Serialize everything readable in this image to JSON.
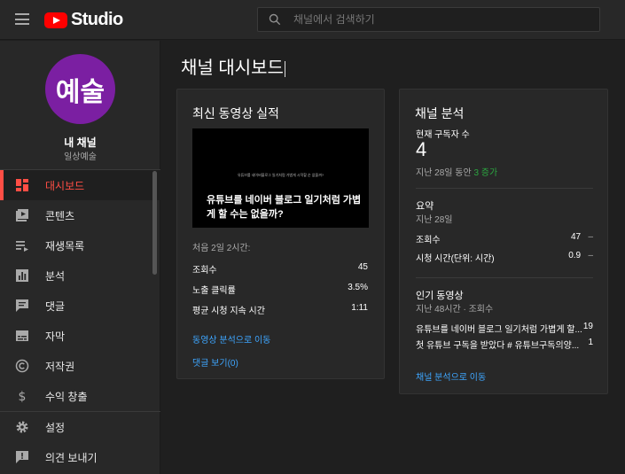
{
  "topbar": {
    "logo_text": "Studio",
    "search_placeholder": "채널에서 검색하기"
  },
  "sidebar": {
    "avatar_text": "예술",
    "channel_name": "내 채널",
    "channel_sub": "일상예술",
    "items": [
      {
        "label": "대시보드",
        "icon": "dashboard-icon"
      },
      {
        "label": "콘텐츠",
        "icon": "video-library-icon"
      },
      {
        "label": "재생목록",
        "icon": "playlist-icon"
      },
      {
        "label": "분석",
        "icon": "analytics-icon"
      },
      {
        "label": "댓글",
        "icon": "comment-icon"
      },
      {
        "label": "자막",
        "icon": "subtitles-icon"
      },
      {
        "label": "저작권",
        "icon": "copyright-icon"
      },
      {
        "label": "수익 창출",
        "icon": "dollar-icon"
      }
    ],
    "bottom_items": [
      {
        "label": "설정",
        "icon": "gear-icon"
      },
      {
        "label": "의견 보내기",
        "icon": "feedback-icon"
      }
    ],
    "accent_color": "#ff4e45"
  },
  "main": {
    "page_title": "채널 대시보드"
  },
  "latest_video": {
    "title": "최신 동영상 실적",
    "thumb_small_text": "유튜브를 네이버블로그 일기처럼 가볍게 시작할 순 없을까?",
    "thumb_big_text": "유튜브를 네이버 블로그 일기처럼 가볍게 할 수는 없을까?",
    "period": "처음 2일 2시간:",
    "stats": [
      {
        "label": "조회수",
        "value": "45"
      },
      {
        "label": "노출 클릭률",
        "value": "3.5%"
      },
      {
        "label": "평균 시청 지속 시간",
        "value": "1:11"
      }
    ],
    "link_analytics": "동영상 분석으로 이동",
    "link_comments": "댓글 보기(0)"
  },
  "channel_analytics": {
    "title": "채널 분석",
    "subs_label": "현재 구독자 수",
    "subs_value": "4",
    "subs_period": "지난 28일 동안",
    "subs_change": "3 증가",
    "summary_title": "요약",
    "summary_period": "지난 28일",
    "summary_rows": [
      {
        "label": "조회수",
        "value": "47",
        "trend": "–"
      },
      {
        "label": "시청 시간(단위: 시간)",
        "value": "0.9",
        "trend": "–"
      }
    ],
    "top_title": "인기 동영상",
    "top_period": "지난 48시간 · 조회수",
    "top_videos": [
      {
        "title": "유튜브를 네이버 블로그 일기처럼 가볍게 할...",
        "views": "19"
      },
      {
        "title": "첫 유튜브 구독을 받았다 # 유튜브구독의양...",
        "views": "1"
      }
    ],
    "link": "채널 분석으로 이동",
    "positive_color": "#2ba640"
  }
}
